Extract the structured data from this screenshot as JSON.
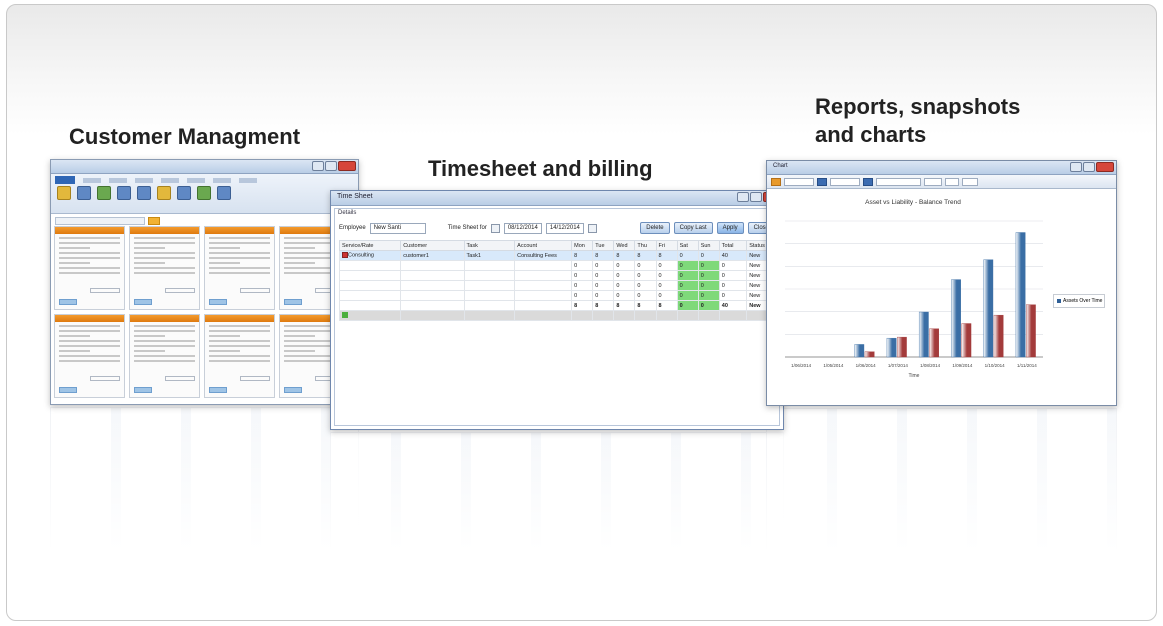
{
  "captions": {
    "customer": "Customer Managment",
    "timesheet": "Timesheet and billing",
    "reports_line1": "Reports, snapshots",
    "reports_line2": "and charts"
  },
  "timesheet_window": {
    "title": "Time Sheet",
    "details_label": "Details",
    "employee_label": "Employee",
    "employee_value": "New Santi",
    "timesheet_for_label": "Time Sheet for",
    "date_from": "08/12/2014",
    "date_to": "14/12/2014",
    "buttons": [
      "Delete",
      "Copy Last",
      "Apply",
      "Close"
    ],
    "columns": [
      "Service/Rate",
      "Customer",
      "Task",
      "Account",
      "Mon",
      "Tue",
      "Wed",
      "Thu",
      "Fri",
      "Sat",
      "Sun",
      "Total",
      "Status"
    ],
    "rows": [
      [
        "Consulting",
        "customer1",
        "Task1",
        "Consulting Fees",
        "8",
        "8",
        "8",
        "8",
        "8",
        "0",
        "0",
        "40",
        "New"
      ],
      [
        "",
        "",
        "",
        "",
        "0",
        "0",
        "0",
        "0",
        "0",
        "0",
        "0",
        "0",
        "New"
      ],
      [
        "",
        "",
        "",
        "",
        "0",
        "0",
        "0",
        "0",
        "0",
        "0",
        "0",
        "0",
        "New"
      ],
      [
        "",
        "",
        "",
        "",
        "0",
        "0",
        "0",
        "0",
        "0",
        "0",
        "0",
        "0",
        "New"
      ],
      [
        "",
        "",
        "",
        "",
        "0",
        "0",
        "0",
        "0",
        "0",
        "0",
        "0",
        "0",
        "New"
      ]
    ],
    "totals": [
      "",
      "",
      "",
      "",
      "8",
      "8",
      "8",
      "8",
      "8",
      "0",
      "0",
      "40",
      "New"
    ]
  },
  "reports_window": {
    "title": "Chart",
    "chart_title": "Asset vs Liability - Balance Trend",
    "legend_label": "Assets Over Time",
    "x_axis_label": "Time"
  },
  "chart_data": {
    "type": "bar",
    "title": "Asset vs Liability - Balance Trend",
    "xlabel": "Time",
    "ylabel": "",
    "categories": [
      "1/06/2014",
      "1/05/2014",
      "1/06/2014",
      "1/07/2014",
      "1/08/2014",
      "1/09/2014",
      "1/10/2014",
      "1/11/2014"
    ],
    "series": [
      {
        "name": "",
        "values": [
          0,
          0,
          12,
          18,
          43,
          74,
          93,
          119
        ],
        "color": "#3a6ea5"
      },
      {
        "name": "",
        "values": [
          0,
          0,
          5,
          19,
          27,
          32,
          40,
          50
        ],
        "color": "#a33b3b"
      }
    ],
    "ylim": [
      0,
      130
    ]
  }
}
